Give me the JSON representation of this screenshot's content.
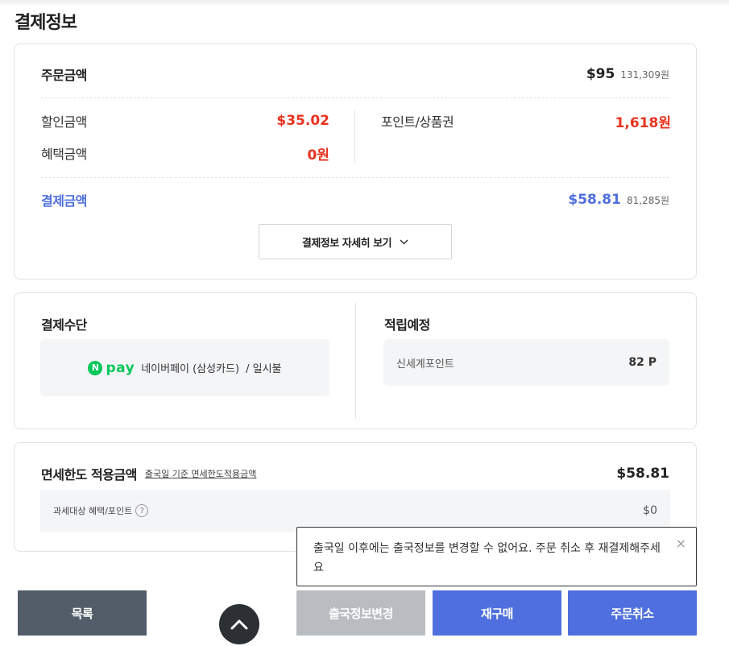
{
  "page_title": "결제정보",
  "summary": {
    "order_label": "주문금액",
    "order_usd": "$95",
    "order_krw": "131,309원",
    "discount_label": "할인금액",
    "discount_value": "$35.02",
    "benefit_label": "혜택금액",
    "benefit_value": "0원",
    "point_label": "포인트/상품권",
    "point_value": "1,618원",
    "payment_label": "결제금액",
    "payment_usd": "$58.81",
    "payment_krw": "81,285원",
    "detail_button": "결제정보 자세히 보기",
    "colors": {
      "red": "#e8321f",
      "blue": "#4f6fde"
    }
  },
  "method": {
    "title": "결제수단",
    "npay_logo_n": "N",
    "npay_logo_text": "pay",
    "pay_name": "네이버페이 (삼성카드)",
    "installment": "/ 일시불",
    "npay_color": "#03c75a"
  },
  "reward": {
    "title": "적립예정",
    "point_label": "신세계포인트",
    "point_value": "82 P"
  },
  "dutyfree": {
    "title": "면세한도 적용금액",
    "subtitle": "출국일 기준 면세한도적용금액",
    "value": "$58.81",
    "tax_label": "과세대상 혜택/포인트",
    "tax_help_icon": "question-icon",
    "tax_value": "$0"
  },
  "tooltip": {
    "text": "출국일 이후에는 출국정보를 변경할 수 없어요. 주문 취소 후 재결제해주세요",
    "close": "×"
  },
  "buttons": {
    "list": "목록",
    "change": "출국정보변경",
    "reorder": "재구매",
    "cancel": "주문취소"
  },
  "scroll_top_icon": "chevron-up-icon"
}
